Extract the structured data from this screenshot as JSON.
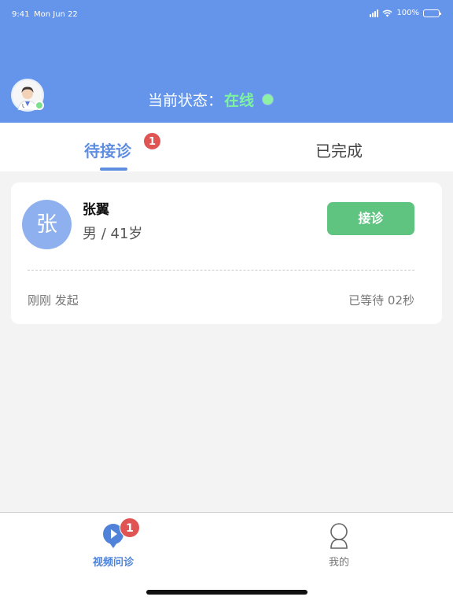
{
  "status_bar": {
    "time": "9:41",
    "date": "Mon Jun 22",
    "battery": "100%"
  },
  "header": {
    "status_label": "当前状态：",
    "status_value": "在线"
  },
  "tabs": [
    {
      "label": "待接诊",
      "badge": "1",
      "active": true
    },
    {
      "label": "已完成",
      "active": false
    }
  ],
  "patient_card": {
    "avatar_char": "张",
    "name": "张翼",
    "info": "男 / 41岁",
    "accept_label": "接诊",
    "initiated": "刚刚 发起",
    "waited": "已等待 02秒"
  },
  "bottom_nav": [
    {
      "label": "视频问诊",
      "icon": "video-consult-icon",
      "badge": "1",
      "active": true
    },
    {
      "label": "我的",
      "icon": "user-icon",
      "active": false
    }
  ],
  "colors": {
    "header_bg": "#6495ea",
    "accent_blue": "#5f8de0",
    "online_green": "#7ef2a0",
    "accept_green": "#5ec47f",
    "badge_red": "#e05454",
    "patient_avatar_bg": "#8fb0ee"
  }
}
